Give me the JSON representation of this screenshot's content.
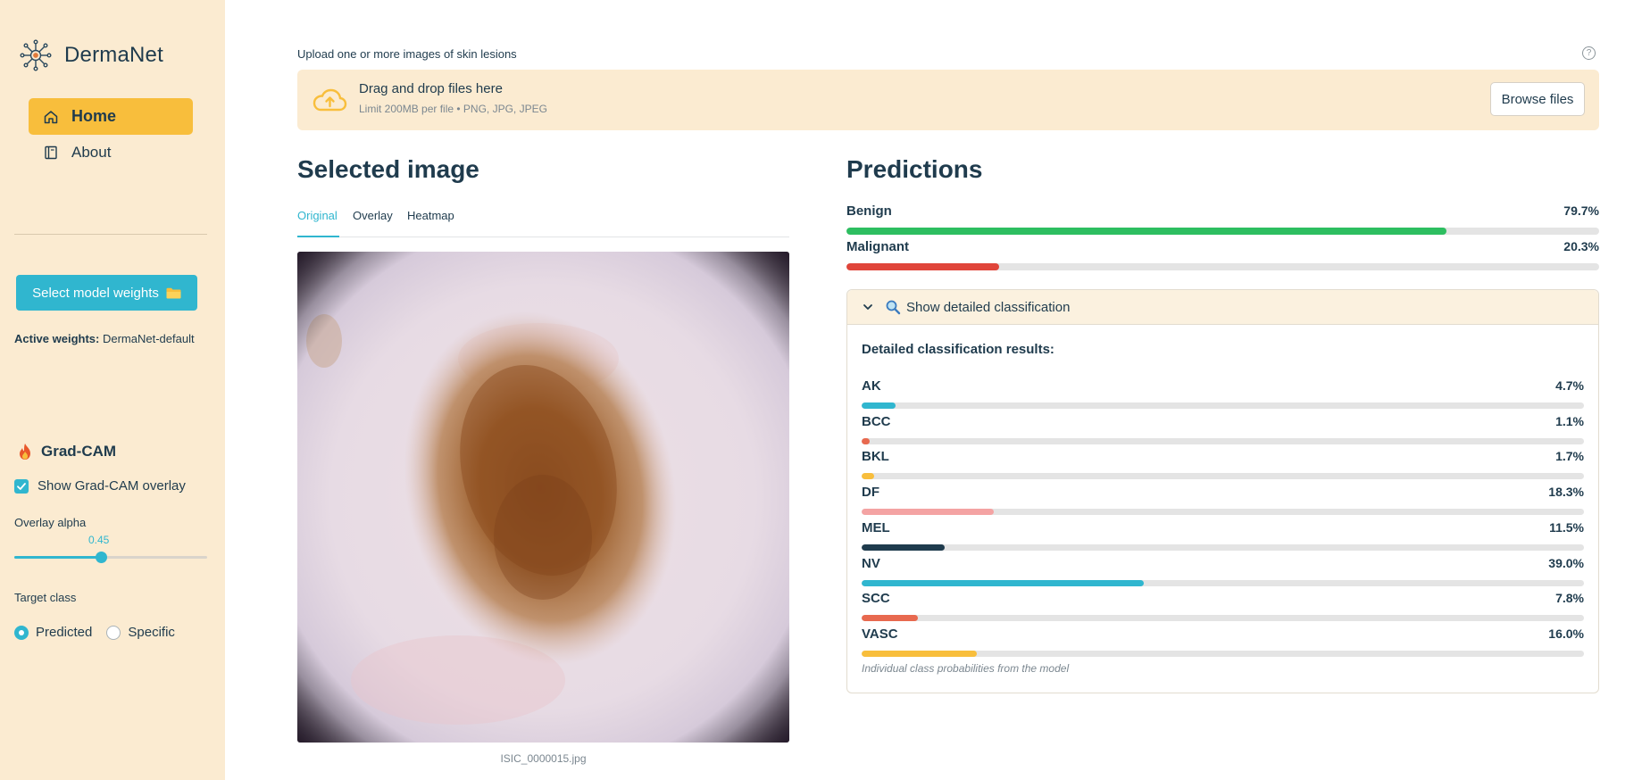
{
  "sidebar": {
    "brand": "DermaNet",
    "nav": [
      {
        "label": "Home",
        "active": true
      },
      {
        "label": "About",
        "active": false
      }
    ],
    "weights_button": "Select model weights",
    "active_weights_label": "Active weights:",
    "active_weights_value": "DermaNet-default",
    "gradcam": {
      "title": "Grad-CAM",
      "show_overlay_label": "Show Grad-CAM overlay",
      "show_overlay_checked": true,
      "alpha_label": "Overlay alpha",
      "alpha_value": "0.45",
      "alpha_fraction": 0.45,
      "target_label": "Target class",
      "target_options": [
        "Predicted",
        "Specific"
      ],
      "target_selected": "Predicted"
    }
  },
  "uploader": {
    "label": "Upload one or more images of skin lesions",
    "drop_title": "Drag and drop files here",
    "drop_sub": "Limit 200MB per file • PNG, JPG, JPEG",
    "browse": "Browse files",
    "help": "?"
  },
  "selected": {
    "title": "Selected image",
    "tabs": [
      "Original",
      "Overlay",
      "Heatmap"
    ],
    "active_tab": "Original",
    "caption": "ISIC_0000015.jpg"
  },
  "predictions": {
    "title": "Predictions",
    "rows": [
      {
        "label": "Benign",
        "value": "79.7%",
        "fraction": 0.797,
        "color": "#2dbe60"
      },
      {
        "label": "Malignant",
        "value": "20.3%",
        "fraction": 0.203,
        "color": "#e0453a"
      }
    ],
    "expander_label": "Show detailed classification",
    "detail_title": "Detailed classification results:",
    "classes": [
      {
        "label": "AK",
        "value": "4.7%",
        "fraction": 0.047,
        "color": "#30b6cf"
      },
      {
        "label": "BCC",
        "value": "1.1%",
        "fraction": 0.011,
        "color": "#e8694f"
      },
      {
        "label": "BKL",
        "value": "1.7%",
        "fraction": 0.017,
        "color": "#f8be3c"
      },
      {
        "label": "DF",
        "value": "18.3%",
        "fraction": 0.183,
        "color": "#f4a3a3"
      },
      {
        "label": "MEL",
        "value": "11.5%",
        "fraction": 0.115,
        "color": "#1f3b4d"
      },
      {
        "label": "NV",
        "value": "39.0%",
        "fraction": 0.39,
        "color": "#30b6cf"
      },
      {
        "label": "SCC",
        "value": "7.8%",
        "fraction": 0.078,
        "color": "#e8694f"
      },
      {
        "label": "VASC",
        "value": "16.0%",
        "fraction": 0.16,
        "color": "#f8be3c"
      }
    ],
    "footnote": "Individual class probabilities from the model"
  }
}
